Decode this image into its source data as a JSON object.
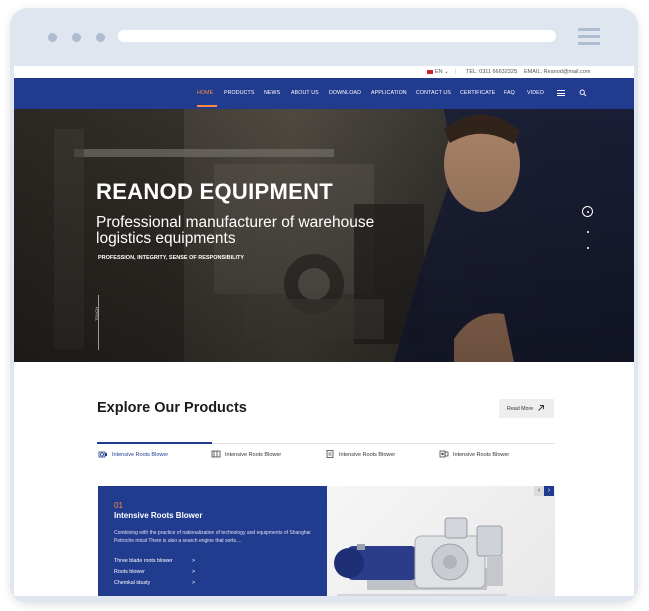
{
  "topbar": {
    "lang": "EN",
    "tel": "TEL: 0311 66632325",
    "email": "EMAIL: Reanod@mail.com",
    "separator": "|"
  },
  "nav": {
    "items": [
      {
        "label": "HOME",
        "active": true
      },
      {
        "label": "PRODUCTS",
        "active": false
      },
      {
        "label": "NEWS",
        "active": false
      },
      {
        "label": "ABOUT US",
        "active": false
      },
      {
        "label": "DOWNLOAD",
        "active": false
      },
      {
        "label": "APPLICATION",
        "active": false
      },
      {
        "label": "CONTACT US",
        "active": false
      },
      {
        "label": "CERTIFICATE",
        "active": false
      },
      {
        "label": "FAQ",
        "active": false
      },
      {
        "label": "VIDEO",
        "active": false
      }
    ],
    "menu_icon": "hamburger-icon",
    "search_icon": "search-icon"
  },
  "hero": {
    "title": "REANOD EQUIPMENT",
    "subtitle": "Professional manufacturer of warehouse logistics equipments",
    "tagline": "PROFESSION, INTEGRITY, SENSE OF RESPONSIBILITY",
    "side_text": "TOUCH"
  },
  "products": {
    "heading": "Explore Our Products",
    "read_more": "Read More",
    "tabs": [
      {
        "label": "Intensive Roots Blower",
        "icon": "blower-icon",
        "active": true
      },
      {
        "label": "Intensive Roots Blower",
        "icon": "machine-icon",
        "active": false
      },
      {
        "label": "Intensive Roots Blower",
        "icon": "device-icon",
        "active": false
      },
      {
        "label": "Intensive Roots Blower",
        "icon": "equipment-icon",
        "active": false
      }
    ],
    "panel": {
      "number": "01",
      "title": "Intensive Roots Blower",
      "description": "Combining with the practice of nationalization of technology and equipments of Shanghai Petroche mical There is also a search engine that sorts....",
      "links": [
        {
          "label": "Three blade roots blower",
          "chevron": ">"
        },
        {
          "label": "Roots blower",
          "chevron": ">"
        },
        {
          "label": "Chemkal idusty",
          "chevron": ">"
        }
      ]
    },
    "prev": "‹",
    "next": "›"
  },
  "colors": {
    "brand_blue": "#213b8f",
    "accent_orange": "#ff8a3d",
    "frame": "#dfe6ef"
  }
}
